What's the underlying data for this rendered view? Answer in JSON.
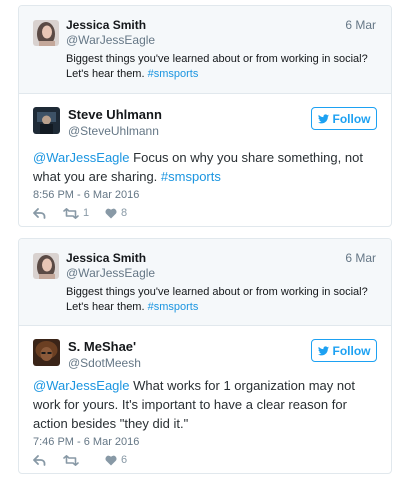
{
  "tweets": [
    {
      "quoted": {
        "name": "Jessica Smith",
        "handle": "@WarJessEagle",
        "date": "6 Mar",
        "text": "Biggest things you've learned about or from working in social? Let's hear them.",
        "hashtag": "#smsports"
      },
      "author": {
        "name": "Steve Uhlmann",
        "handle": "@SteveUhlmann"
      },
      "follow_label": "Follow",
      "reply": {
        "mention": "@WarJessEagle",
        "text": " Focus on why you share something, not what you are sharing. ",
        "hashtag": "#smsports"
      },
      "timestamp": "8:56 PM - 6 Mar 2016",
      "retweets": "1",
      "likes": "8"
    },
    {
      "quoted": {
        "name": "Jessica Smith",
        "handle": "@WarJessEagle",
        "date": "6 Mar",
        "text": "Biggest things you've learned about or from working in social? Let's hear them.",
        "hashtag": "#smsports"
      },
      "author": {
        "name": "S. MeShae'",
        "handle": "@SdotMeesh"
      },
      "follow_label": "Follow",
      "reply": {
        "mention": "@WarJessEagle",
        "text": " What works for 1 organization may not work for yours. It's important to have a clear reason for action besides \"they did it.\"",
        "hashtag": ""
      },
      "timestamp": "7:46 PM - 6 Mar 2016",
      "retweets": "",
      "likes": "6"
    }
  ],
  "colors": {
    "accent": "#1da1f2",
    "link": "#1b95e0",
    "quote_bg": "#f5f8fa",
    "border": "#e1e8ed",
    "muted": "#657786"
  },
  "icons": [
    "jessica-avatar",
    "steve-avatar",
    "meshae-avatar",
    "twitter-bird-icon",
    "reply-icon",
    "retweet-icon",
    "heart-icon"
  ]
}
